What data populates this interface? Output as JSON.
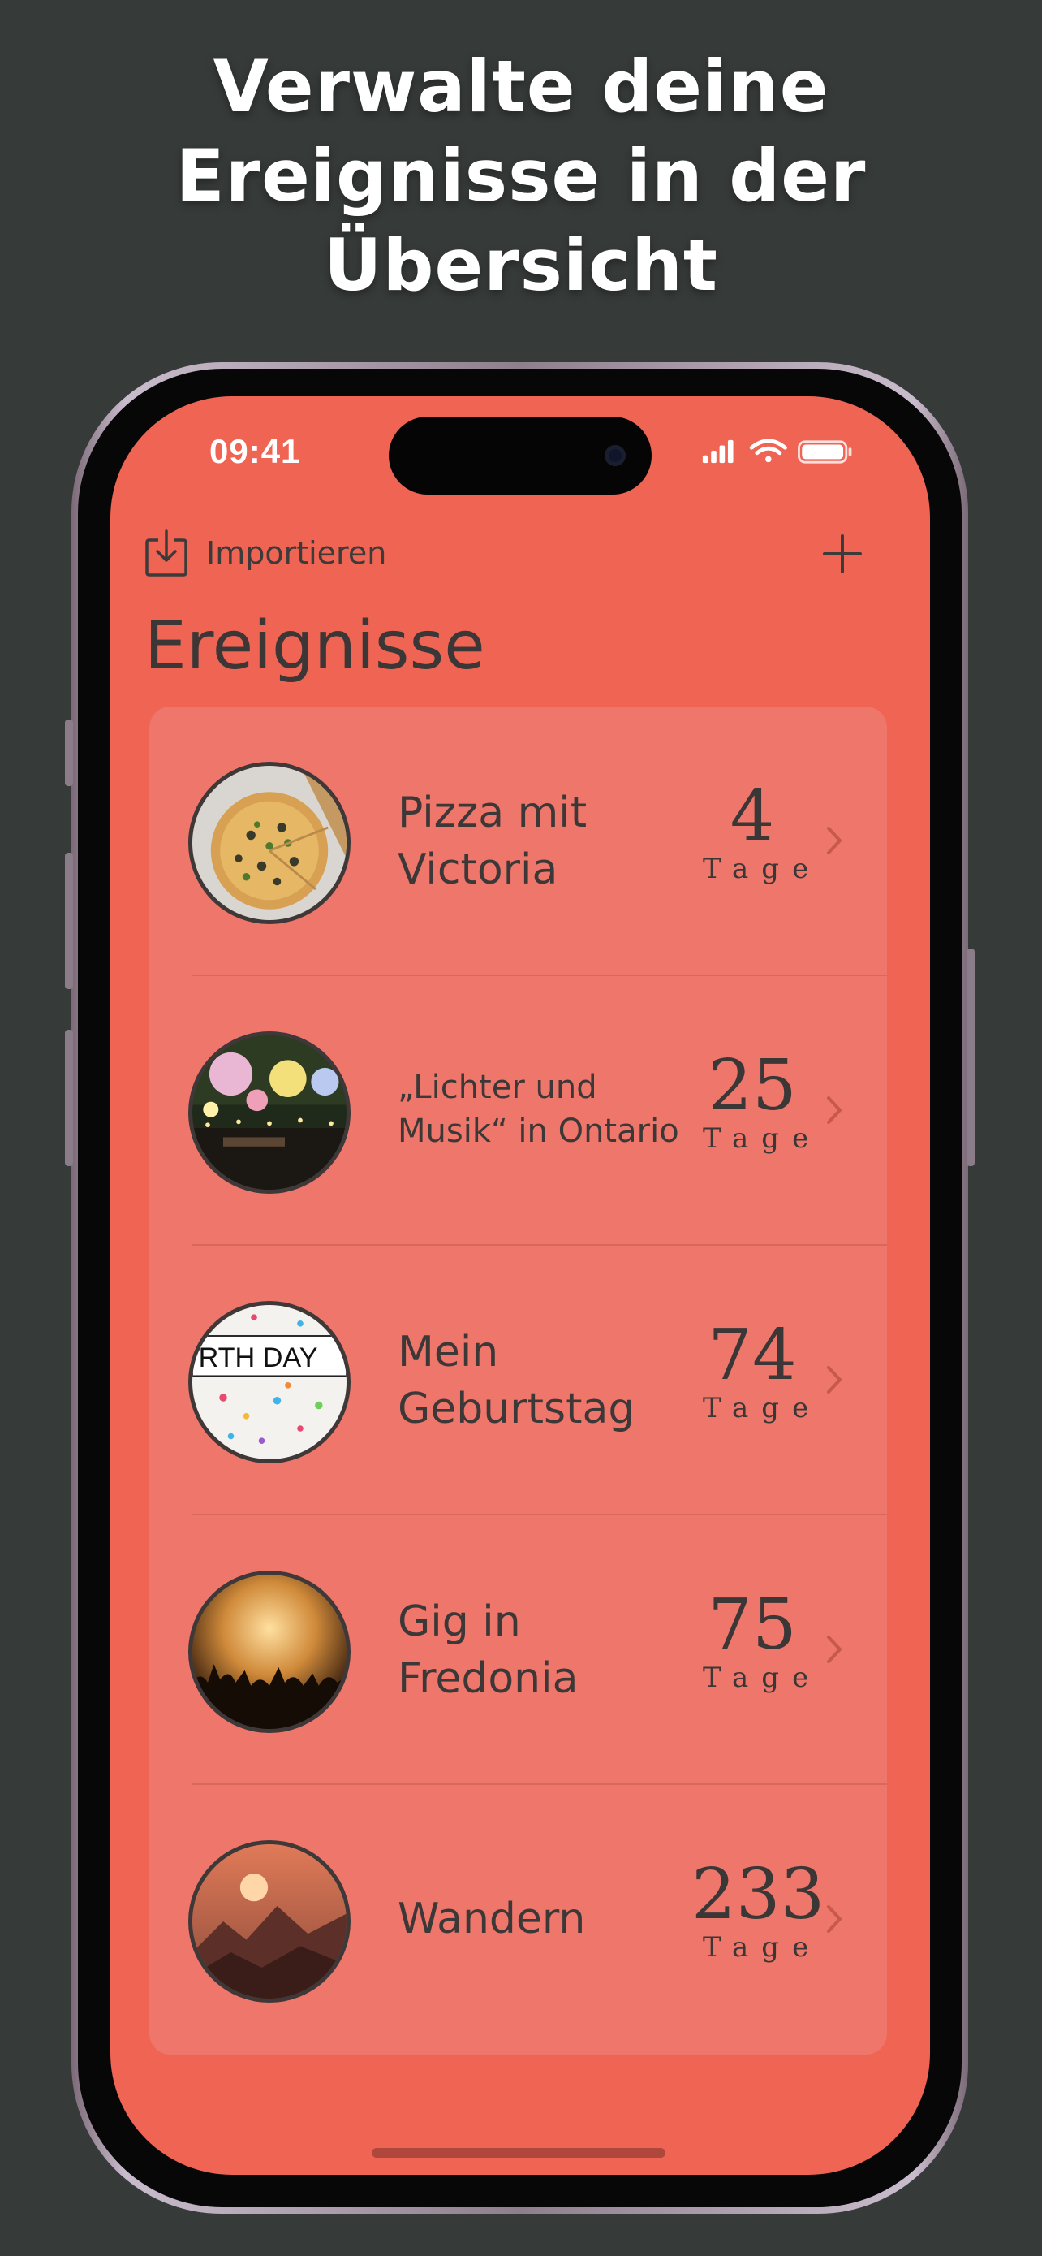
{
  "headline": [
    "Verwalte deine",
    "Ereignisse in der",
    "Übersicht"
  ],
  "status_bar": {
    "time": "09:41"
  },
  "nav": {
    "import_label": "Importieren",
    "add_icon": "plus-icon",
    "import_icon": "import-tray-icon"
  },
  "page_title": "Ereignisse",
  "events": [
    {
      "title_lines": [
        "Pizza mit",
        "Victoria"
      ],
      "days": "4",
      "unit": "Tage",
      "image": "pizza"
    },
    {
      "title_lines": [
        "„Lichter und",
        "Musik“ in Ontario"
      ],
      "days": "25",
      "unit": "Tage",
      "image": "lanterns"
    },
    {
      "title_lines": [
        "Mein",
        "Geburtstag"
      ],
      "days": "74",
      "unit": "Tage",
      "image": "birthday",
      "image_text": "RTH DAY"
    },
    {
      "title_lines": [
        "Gig in",
        "Fredonia"
      ],
      "days": "75",
      "unit": "Tage",
      "image": "concert"
    },
    {
      "title_lines": [
        "Wandern"
      ],
      "days": "233",
      "unit": "Tage",
      "image": "mountains"
    }
  ],
  "colors": {
    "background": "#363a39",
    "screen": "#f06454",
    "card": "#ef766a",
    "text": "#3b3737"
  }
}
